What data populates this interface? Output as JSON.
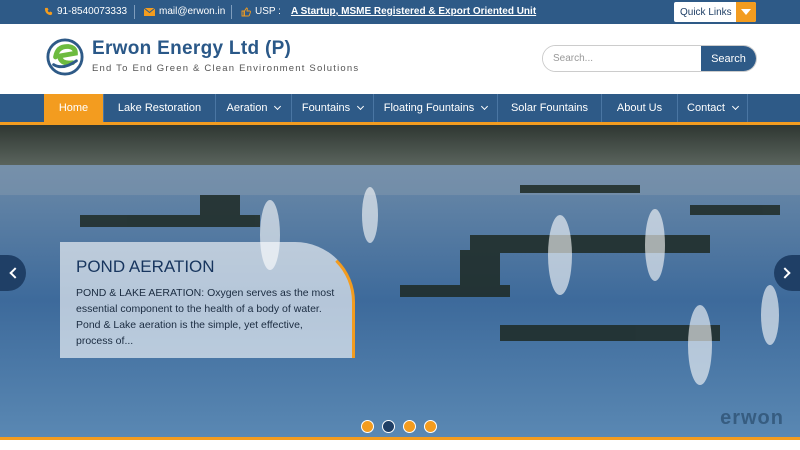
{
  "topbar": {
    "phone": "91-8540073333",
    "email": "mail@erwon.in",
    "usp_label": "USP :",
    "usp_text": "A Startup, MSME Registered & Export Oriented Unit",
    "quick_links": "Quick Links"
  },
  "header": {
    "title": "Erwon Energy Ltd (P)",
    "subtitle": "End To End Green & Clean Environment Solutions",
    "search_placeholder": "Search...",
    "search_button": "Search"
  },
  "nav": {
    "items": [
      {
        "label": "Home",
        "active": true,
        "dropdown": false
      },
      {
        "label": "Lake Restoration",
        "active": false,
        "dropdown": false
      },
      {
        "label": "Aeration",
        "active": false,
        "dropdown": true
      },
      {
        "label": "Fountains",
        "active": false,
        "dropdown": true
      },
      {
        "label": "Floating Fountains",
        "active": false,
        "dropdown": true
      },
      {
        "label": "Solar Fountains",
        "active": false,
        "dropdown": false
      },
      {
        "label": "About Us",
        "active": false,
        "dropdown": false
      },
      {
        "label": "Contact",
        "active": false,
        "dropdown": true
      }
    ]
  },
  "slider": {
    "caption_title": "POND AERATION",
    "caption_text": " POND & LAKE AERATION: Oxygen serves as the most essential component to the health of a body of water. Pond & Lake aeration is the simple, yet effective, process of...",
    "watermark": "erwon",
    "dots": 4,
    "active_dot": 1
  },
  "colors": {
    "primary": "#2e5a87",
    "accent": "#f39c1f",
    "dark": "#1f3f66"
  }
}
